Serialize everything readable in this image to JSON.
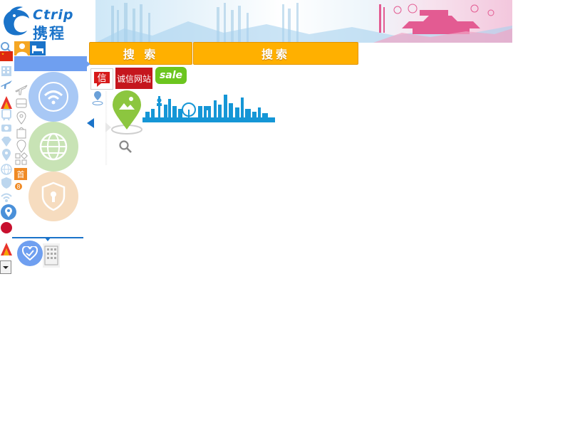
{
  "logo": {
    "brand_en": "Ctrip",
    "brand_cn": "携程"
  },
  "search": {
    "button1": "搜 索",
    "button2": "搜索"
  },
  "badges": {
    "xin": "信",
    "chengxin": "诚信网站",
    "sale": "sale"
  },
  "misc": {
    "shou": "首",
    "hot_number": "8"
  },
  "colors": {
    "brand_blue": "#1a73c9",
    "search_orange": "#ffb000",
    "bar_blue": "#6f9ff0",
    "wifi_circle": "#a8c8f5",
    "globe_circle": "#c8e3b5",
    "shield_circle": "#f6dcbf",
    "heart_circle": "#6f9ff0",
    "sale_green": "#6cc51f",
    "cx_red": "#c5161d"
  },
  "icons": [
    "search-icon",
    "profile-icon",
    "bed-icon",
    "china-flag-icon",
    "hotel-icon",
    "plane-icon",
    "tour-icon",
    "train-icon",
    "car-icon",
    "diamond-icon",
    "location-icon",
    "globe-icon",
    "shield-icon",
    "wifi-icon",
    "map-pin-icon",
    "red-dot-icon",
    "heart-icon",
    "building-icon",
    "dropdown-arrow-icon",
    "map-photo-pin-icon",
    "city-skyline-icon"
  ]
}
